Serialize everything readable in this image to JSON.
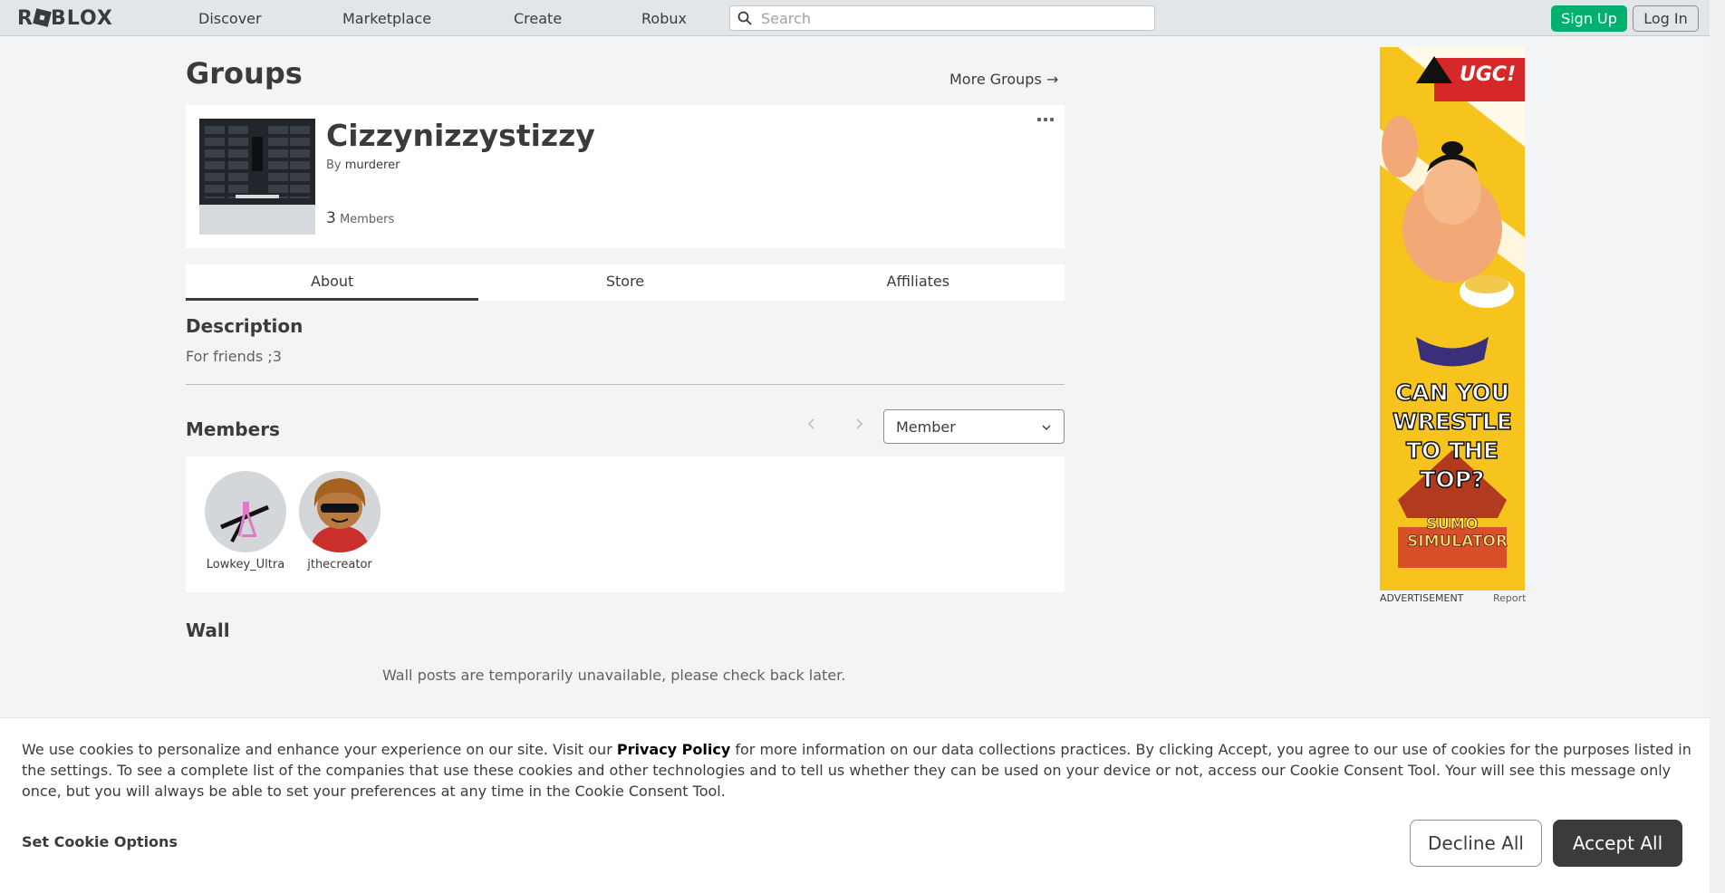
{
  "topbar": {
    "logo": "ROBLOX",
    "nav": [
      "Discover",
      "Marketplace",
      "Create",
      "Robux"
    ],
    "search_placeholder": "Search",
    "signup_label": "Sign Up",
    "login_label": "Log In"
  },
  "page": {
    "title": "Groups",
    "more_groups": "More Groups →"
  },
  "group": {
    "name": "Cizzynizzystizzy",
    "by_label": "By",
    "owner": "murderer",
    "member_count": "3",
    "members_label": "Members"
  },
  "tabs": [
    {
      "label": "About",
      "active": true
    },
    {
      "label": "Store",
      "active": false
    },
    {
      "label": "Affiliates",
      "active": false
    }
  ],
  "description": {
    "heading": "Description",
    "text": "For friends ;3"
  },
  "members_section": {
    "heading": "Members",
    "role_filter": "Member",
    "members": [
      {
        "name": "Lowkey_Ultra"
      },
      {
        "name": "jthecreator"
      }
    ]
  },
  "wall": {
    "heading": "Wall",
    "message": "Wall posts are temporarily unavailable, please check back later."
  },
  "ad": {
    "badge": "UGC!",
    "headline": "CAN YOU WRESTLE TO THE TOP?",
    "brand_line1": "SUMO",
    "brand_line2": "SIMULATOR",
    "footer_left": "ADVERTISEMENT",
    "footer_right": "Report",
    "colors": {
      "background": "#f7c41e",
      "stripe": "#ffffff"
    }
  },
  "cookie_banner": {
    "text_before": "We use cookies to personalize and enhance your experience on our site. Visit our ",
    "privacy_link": "Privacy Policy",
    "text_after": " for more information on our data collections practices. By clicking Accept, you agree to our use of cookies for the purposes listed in the settings. To see a complete list of the companies that use these cookies and other technologies and to tell us whether they can be used on your device or not, access our Cookie Consent Tool. Your will see this message only once, but you will always be able to set your preferences at any time in the Cookie Consent Tool.",
    "set_options": "Set Cookie Options",
    "decline": "Decline All",
    "accept": "Accept All"
  },
  "colors": {
    "signup_green": "#00b06f",
    "page_bg": "#f2f4f5",
    "text": "#393b3d"
  }
}
